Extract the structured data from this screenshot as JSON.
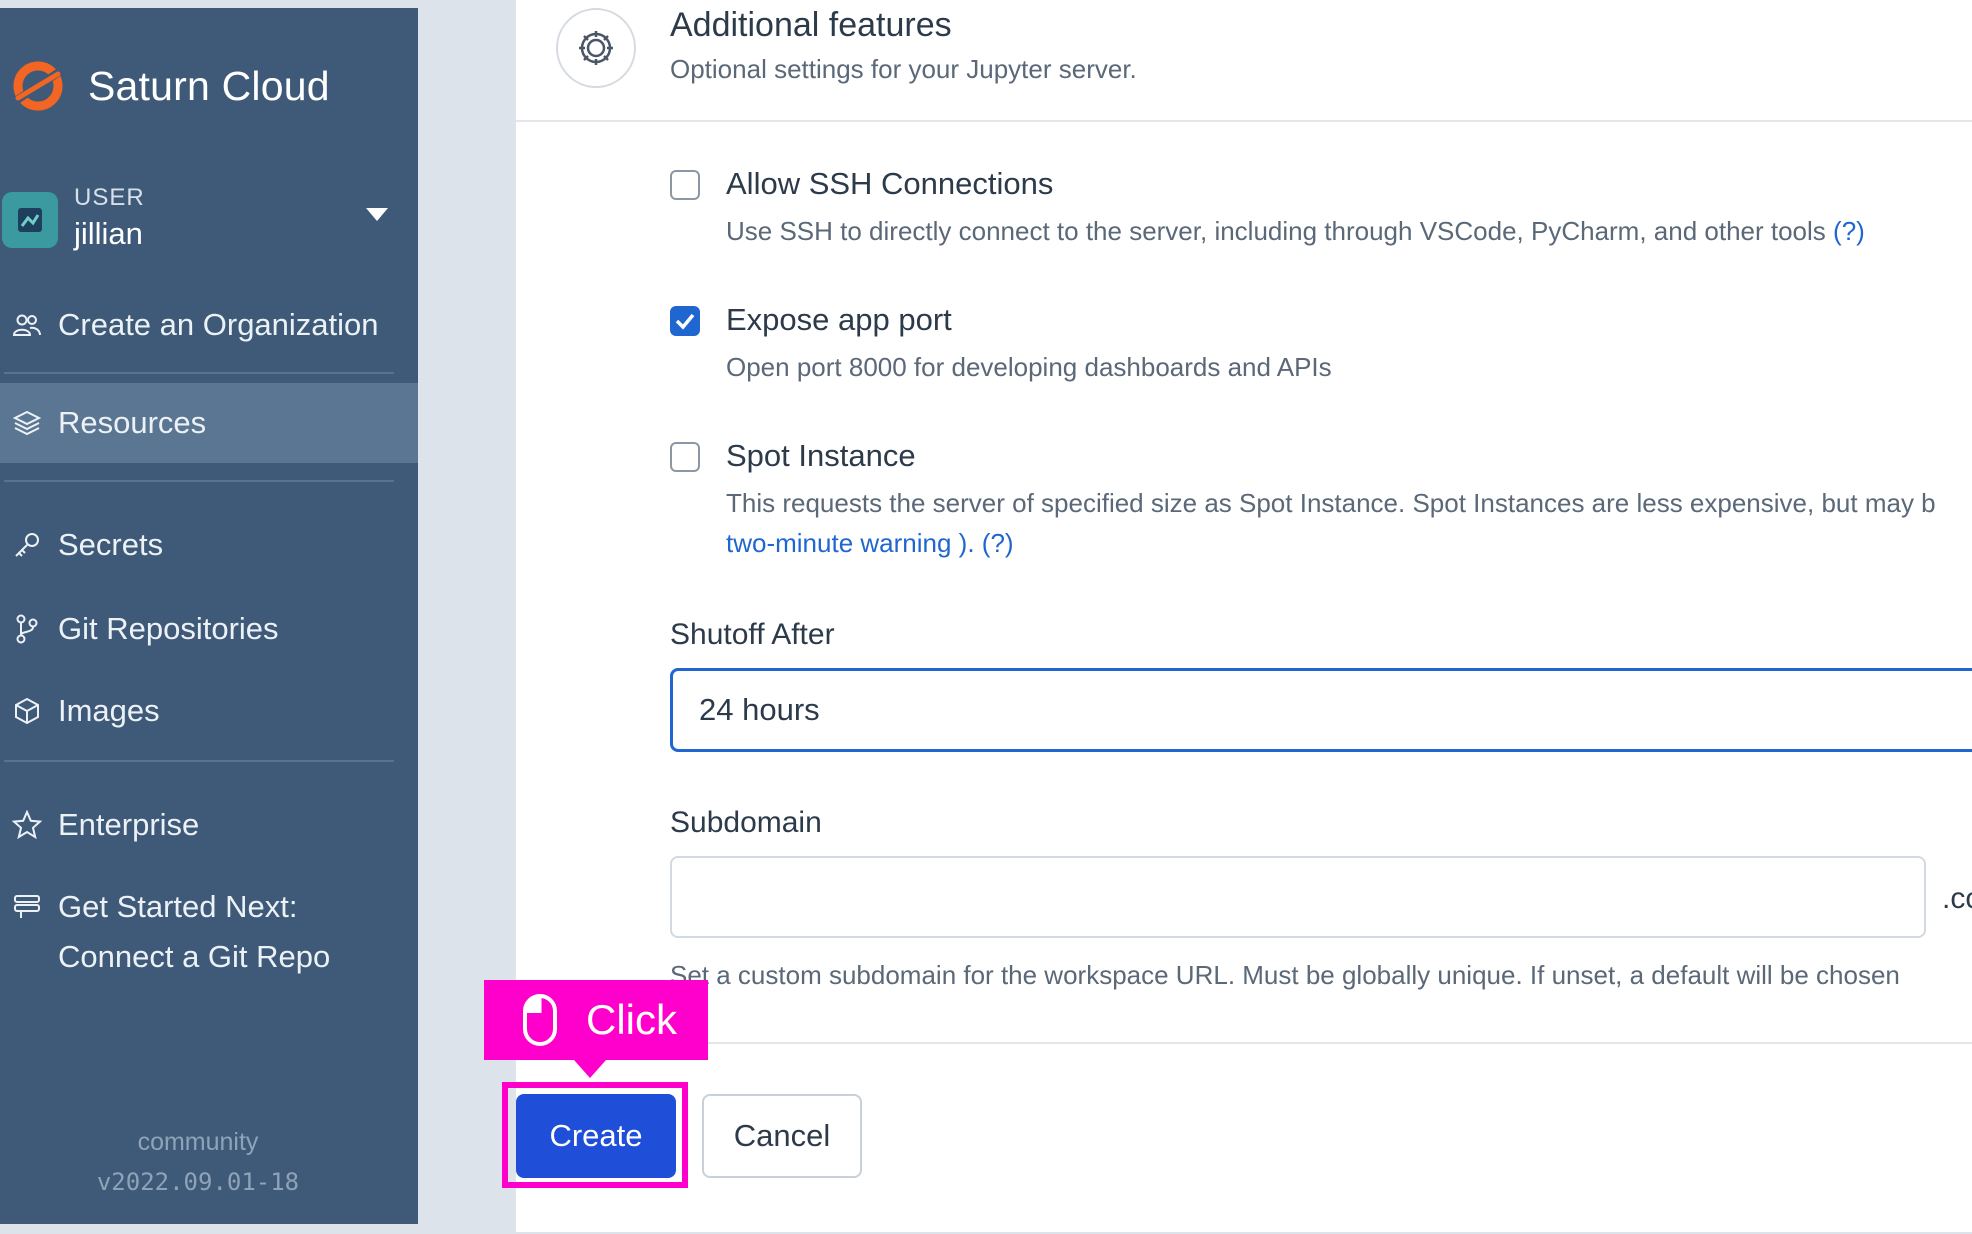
{
  "app": {
    "name": "Saturn Cloud"
  },
  "user": {
    "role": "USER",
    "name": "jillian"
  },
  "nav": {
    "create_org": "Create an Organization",
    "resources": "Resources",
    "secrets": "Secrets",
    "git": "Git Repositories",
    "images": "Images",
    "enterprise": "Enterprise",
    "get_started_1": "Get Started Next:",
    "get_started_2": "Connect a Git Repo"
  },
  "footer": {
    "edition": "community",
    "version": "v2022.09.01-18"
  },
  "section": {
    "title": "Additional features",
    "subtitle": "Optional settings for your Jupyter server."
  },
  "options": {
    "ssh": {
      "title": "Allow SSH Connections",
      "desc": "Use SSH to directly connect to the server, including through VSCode, PyCharm, and other tools",
      "help": "(?)",
      "checked": false
    },
    "app_port": {
      "title": "Expose app port",
      "desc": "Open port 8000 for developing dashboards and APIs",
      "checked": true
    },
    "spot": {
      "title": "Spot Instance",
      "desc": "This requests the server of specified size as Spot Instance. Spot Instances are less expensive, but may b",
      "link": "two-minute warning",
      "after_link": " ). ",
      "help": "(?)",
      "checked": false
    }
  },
  "shutoff": {
    "label": "Shutoff After",
    "value": "24 hours"
  },
  "subdomain": {
    "label": "Subdomain",
    "value": "",
    "suffix": ".co",
    "help": "Set a custom subdomain for the workspace URL. Must be globally unique. If unset, a default will be chosen"
  },
  "buttons": {
    "create": "Create",
    "cancel": "Cancel"
  },
  "annotation": {
    "label": "Click"
  },
  "colors": {
    "sidebar": "#3e5a78",
    "primary": "#1f4ed8",
    "highlight": "#ff00cc",
    "link": "#1f66d1"
  }
}
